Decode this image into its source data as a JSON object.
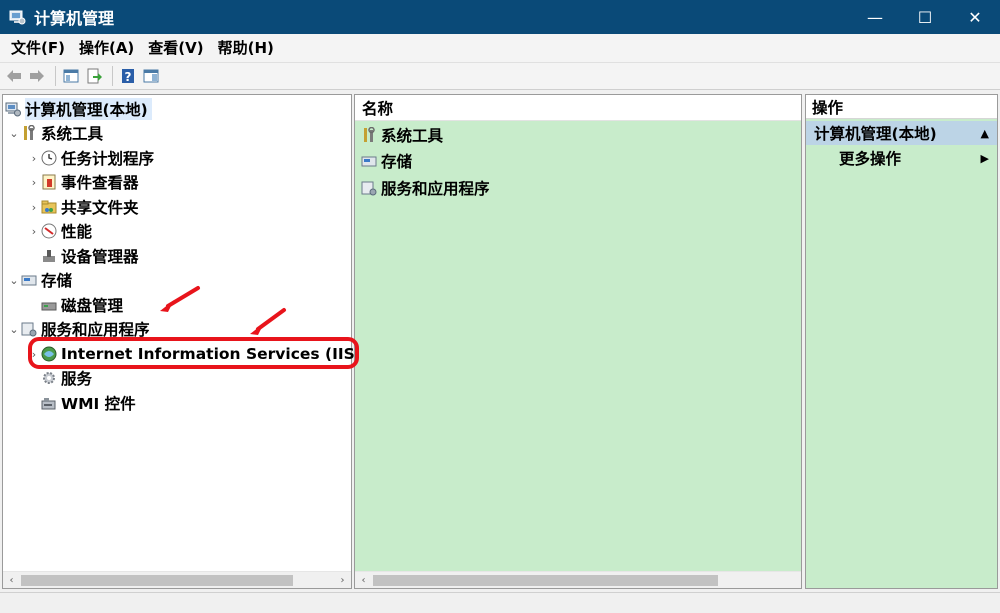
{
  "window": {
    "title": "计算机管理",
    "controls": {
      "minimize": "—",
      "maximize": "☐",
      "close": "✕"
    }
  },
  "menu": [
    "文件(F)",
    "操作(A)",
    "查看(V)",
    "帮助(H)"
  ],
  "toolbar": {
    "buttons": [
      "back-icon",
      "forward-icon",
      "show-hide-tree-icon",
      "export-icon",
      "help-icon",
      "properties-icon"
    ]
  },
  "tree": {
    "root": "计算机管理(本地)",
    "system_tools": {
      "label": "系统工具",
      "children": [
        "任务计划程序",
        "事件查看器",
        "共享文件夹",
        "性能",
        "设备管理器"
      ]
    },
    "storage": {
      "label": "存储",
      "children": [
        "磁盘管理"
      ]
    },
    "services_apps": {
      "label": "服务和应用程序",
      "children": [
        "Internet Information Services (IIS)",
        "服务",
        "WMI 控件"
      ]
    }
  },
  "middle": {
    "column_header": "名称",
    "items": [
      "系统工具",
      "存储",
      "服务和应用程序"
    ]
  },
  "actions": {
    "header": "操作",
    "group": "计算机管理(本地)",
    "items": [
      "更多操作"
    ]
  },
  "colors": {
    "titlebar": "#0a4a78",
    "pane_green": "#c8eccb",
    "highlight_red": "#e8141b",
    "selection": "#bcd4e6"
  }
}
